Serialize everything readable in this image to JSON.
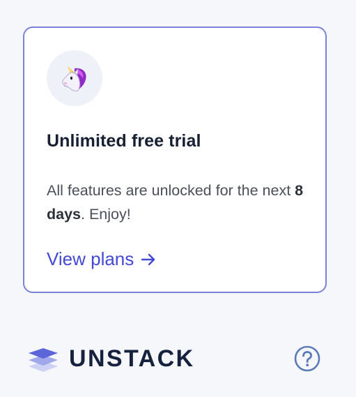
{
  "card": {
    "icon": "unicorn-icon",
    "title": "Unlimited free trial",
    "description_before": "All features are unlocked for the next ",
    "description_bold": "8 days",
    "description_after": ". Enjoy!",
    "cta_label": "View plans",
    "cta_icon": "arrow-right-icon"
  },
  "footer": {
    "brand": "UNSTACK",
    "brand_icon": "stacked-layers-icon",
    "help_icon": "help-circle-icon"
  },
  "colors": {
    "card_border": "#7c82d9",
    "cta": "#4349d2",
    "title": "#172033",
    "help_icon": "#5b7bb8"
  }
}
